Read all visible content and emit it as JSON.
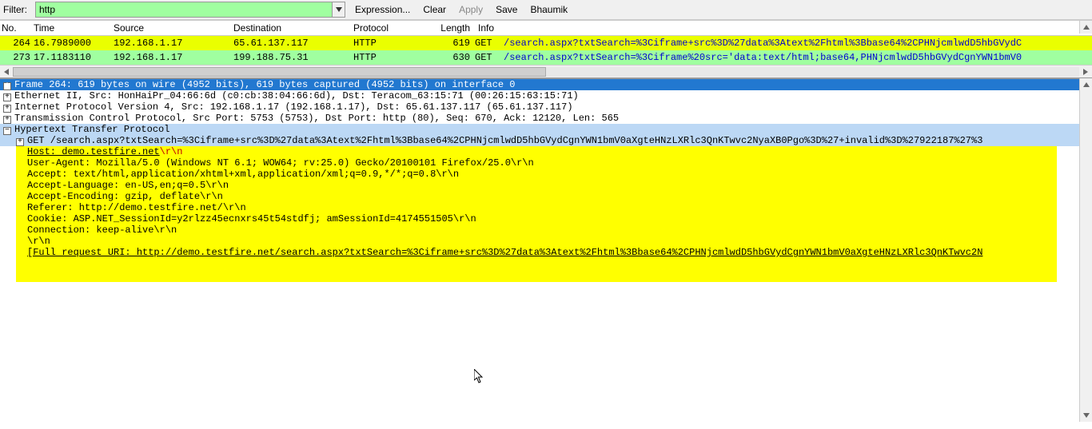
{
  "filter": {
    "label": "Filter:",
    "value": "http",
    "expression": "Expression...",
    "clear": "Clear",
    "apply": "Apply",
    "save": "Save",
    "bhaumik": "Bhaumik"
  },
  "columns": {
    "no": "No.",
    "time": "Time",
    "source": "Source",
    "destination": "Destination",
    "protocol": "Protocol",
    "length": "Length",
    "info": "Info"
  },
  "packets": [
    {
      "no": "264",
      "time": "16.7989000",
      "source": "192.168.1.17",
      "destination": "65.61.137.117",
      "protocol": "HTTP",
      "length": "619",
      "info_method": "GET",
      "info_path": "/search.aspx?txtSearch=%3Ciframe+src%3D%27data%3Atext%2Fhtml%3Bbase64%2CPHNjcmlwdD5hbGVydC"
    },
    {
      "no": "273",
      "time": "17.1183110",
      "source": "192.168.1.17",
      "destination": "199.188.75.31",
      "protocol": "HTTP",
      "length": "630",
      "info_method": "GET",
      "info_path": "/search.aspx?txtSearch=%3Ciframe%20src='data:text/html;base64,PHNjcmlwdD5hbGVydCgnYWN1bmV0"
    }
  ],
  "details": {
    "frame": "Frame 264: 619 bytes on wire (4952 bits), 619 bytes captured (4952 bits) on interface 0",
    "eth": "Ethernet II, Src: HonHaiPr_04:66:6d (c0:cb:38:04:66:6d), Dst: Teracom_63:15:71 (00:26:15:63:15:71)",
    "ip": "Internet Protocol Version 4, Src: 192.168.1.17 (192.168.1.17), Dst: 65.61.137.117 (65.61.137.117)",
    "tcp": "Transmission Control Protocol, Src Port: 5753 (5753), Dst Port: http (80), Seq: 670, Ack: 12120, Len: 565",
    "http_label": "Hypertext Transfer Protocol",
    "http": {
      "request": "GET /search.aspx?txtSearch=%3Ciframe+src%3D%27data%3Atext%2Fhtml%3Bbase64%2CPHNjcmlwdD5hbGVydCgnYWN1bmV0aXgteHNzLXRlc3QnKTwvc2NyaXB0Pgo%3D%27+invalid%3D%27922187%27%3",
      "host_label": "Host: demo.testfire.net",
      "host_crlf": "\\r\\n",
      "ua": "User-Agent: Mozilla/5.0 (Windows NT 6.1; WOW64; rv:25.0) Gecko/20100101 Firefox/25.0\\r\\n",
      "accept": "Accept: text/html,application/xhtml+xml,application/xml;q=0.9,*/*;q=0.8\\r\\n",
      "accept_lang": "Accept-Language: en-US,en;q=0.5\\r\\n",
      "accept_enc": "Accept-Encoding: gzip, deflate\\r\\n",
      "referer": "Referer: http://demo.testfire.net/\\r\\n",
      "cookie": "Cookie: ASP.NET_SessionId=y2rlzz45ecnxrs45t54stdfj; amSessionId=4174551505\\r\\n",
      "connection": "Connection: keep-alive\\r\\n",
      "crlf": "\\r\\n",
      "full_uri": "[Full request URI: http://demo.testfire.net/search.aspx?txtSearch=%3Ciframe+src%3D%27data%3Atext%2Fhtml%3Bbase64%2CPHNjcmlwdD5hbGVydCgnYWN1bmV0aXgteHNzLXRlc3QnKTwvc2N"
    }
  }
}
